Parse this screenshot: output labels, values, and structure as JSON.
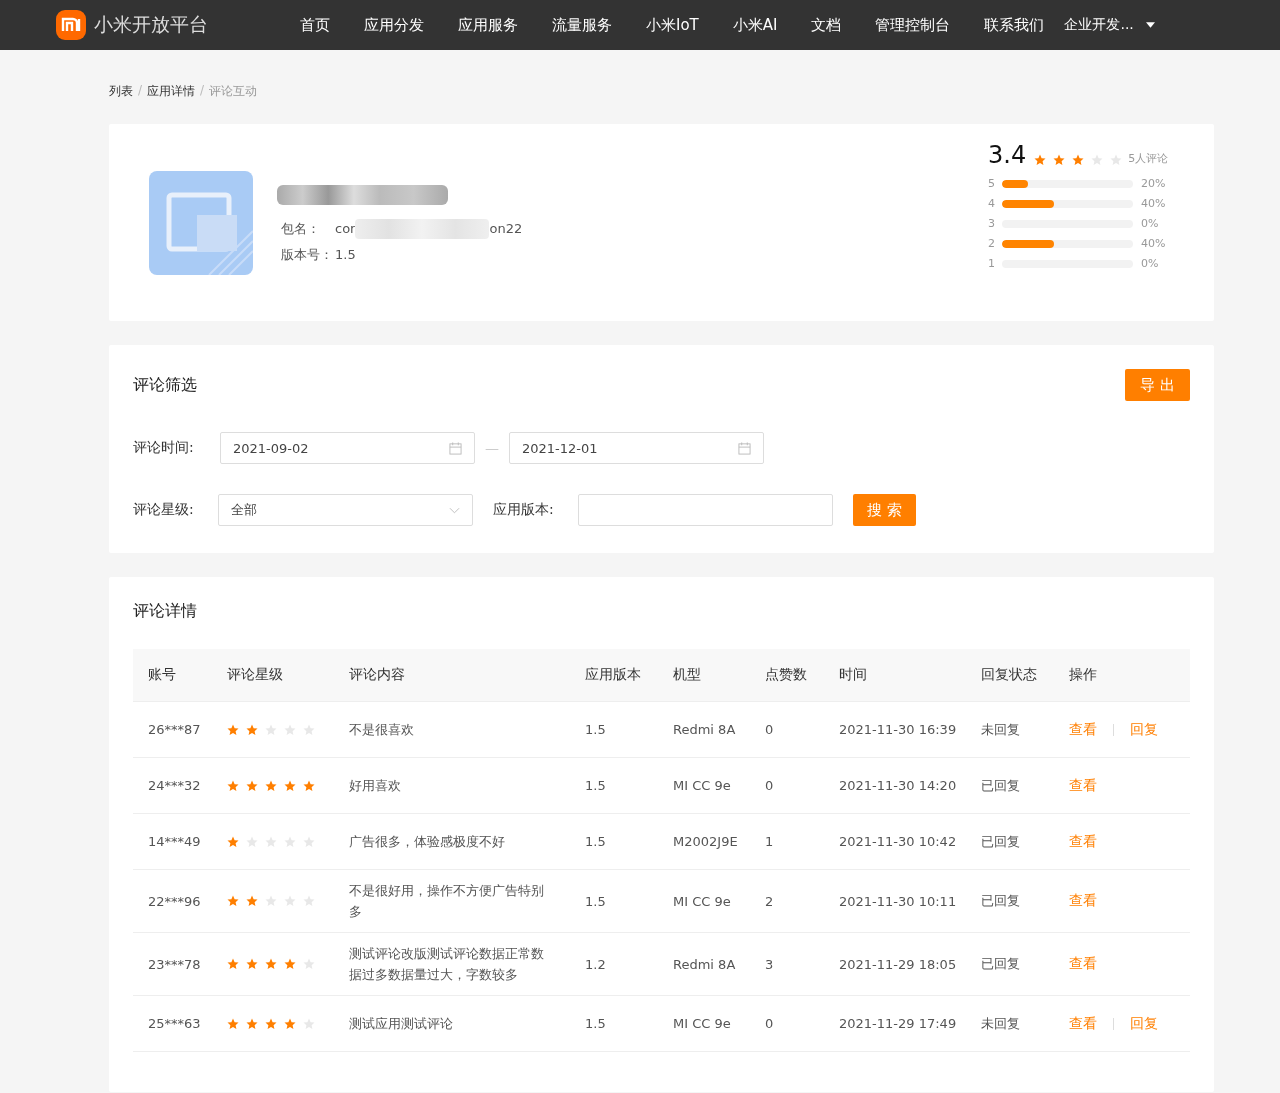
{
  "header": {
    "brand": "小米开放平台",
    "nav": [
      "首页",
      "应用分发",
      "应用服务",
      "流量服务",
      "小米IoT",
      "小米AI",
      "文档",
      "管理控制台",
      "联系我们"
    ],
    "account": "企业开发..."
  },
  "breadcrumb": [
    {
      "label": "列表",
      "current": false
    },
    {
      "separator": "/"
    },
    {
      "label": "应用详情",
      "current": false
    },
    {
      "separator": "/"
    },
    {
      "label": "评论互动",
      "current": true
    }
  ],
  "app": {
    "package_label": "包名：",
    "package_start": "cor",
    "package_end": "on22",
    "version_label": "版本号：",
    "version": "1.5"
  },
  "rating": {
    "score": "3.4",
    "stars": 3,
    "count": "5人评论",
    "bars": [
      {
        "star": "5",
        "level": 0.2,
        "percent": "20%"
      },
      {
        "star": "4",
        "level": 0.4,
        "percent": "40%"
      },
      {
        "star": "3",
        "level": 0,
        "percent": "0%"
      },
      {
        "star": "2",
        "level": 0.4,
        "percent": "40%"
      },
      {
        "star": "1",
        "level": 0,
        "percent": "0%"
      }
    ]
  },
  "filter": {
    "title": "评论筛选",
    "export": "导 出",
    "time_label": "评论时间:",
    "date_from": "2021-09-02",
    "date_sep": "—",
    "date_to": "2021-12-01",
    "stars_label": "评论星级:",
    "stars_value": "全部",
    "version_label": "应用版本:",
    "search": "搜 索"
  },
  "table": {
    "title": "评论详情",
    "columns": [
      "账号",
      "评论星级",
      "评论内容",
      "应用版本",
      "机型",
      "点赞数",
      "时间",
      "回复状态",
      "操作"
    ],
    "rows": [
      {
        "account": "26***87",
        "stars": 2,
        "content": "不是很喜欢",
        "version": "1.5",
        "model": "Redmi 8A",
        "likes": "0",
        "time": "2021-11-30 16:39",
        "status": "未回复",
        "actions": [
          "查看",
          "回复"
        ]
      },
      {
        "account": "24***32",
        "stars": 5,
        "content": "好用喜欢",
        "version": "1.5",
        "model": "MI CC 9e",
        "likes": "0",
        "time": "2021-11-30 14:20",
        "status": "已回复",
        "actions": [
          "查看"
        ]
      },
      {
        "account": "14***49",
        "stars": 1,
        "content": "广告很多，体验感极度不好",
        "version": "1.5",
        "model": "M2002J9E",
        "likes": "1",
        "time": "2021-11-30 10:42",
        "status": "已回复",
        "actions": [
          "查看"
        ]
      },
      {
        "account": "22***96",
        "stars": 2,
        "content": "不是很好用，操作不方便广告特别多",
        "version": "1.5",
        "model": "MI CC 9e",
        "likes": "2",
        "time": "2021-11-30 10:11",
        "status": "已回复",
        "actions": [
          "查看"
        ]
      },
      {
        "account": "23***78",
        "stars": 4,
        "content": "测试评论改版测试评论数据正常数据过多数据量过大，字数较多",
        "version": "1.2",
        "model": "Redmi 8A",
        "likes": "3",
        "time": "2021-11-29 18:05",
        "status": "已回复",
        "actions": [
          "查看"
        ]
      },
      {
        "account": "25***63",
        "stars": 4,
        "content": "测试应用测试评论",
        "version": "1.5",
        "model": "MI CC 9e",
        "likes": "0",
        "time": "2021-11-29 17:49",
        "status": "未回复",
        "actions": [
          "查看",
          "回复"
        ]
      }
    ]
  }
}
